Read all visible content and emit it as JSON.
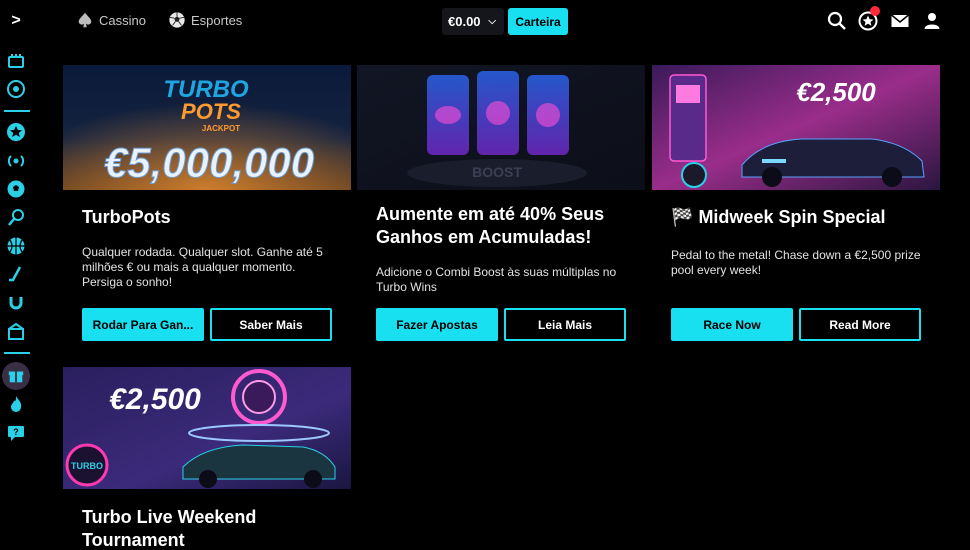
{
  "nav": {
    "casino_label": "Cassino",
    "sports_label": "Esportes",
    "balance": "€0.00",
    "wallet_label": "Carteira"
  },
  "sidebar": {
    "icons": [
      "casino-chips-icon",
      "roulette-icon",
      "favorites-star-icon",
      "live-broadcast-icon",
      "soccer-ball-icon",
      "tennis-racket-icon",
      "basketball-icon",
      "hockey-stick-icon",
      "horseshoe-icon",
      "betting-shop-icon",
      "gift-icon",
      "fire-icon",
      "help-chat-icon"
    ]
  },
  "cards": [
    {
      "banner_text": "€5,000,000",
      "banner_logo_line1": "TURBO",
      "banner_logo_line2": "POTS",
      "banner_logo_line3": "JACKPOT",
      "title": "TurboPots",
      "description": "Qualquer rodada. Qualquer slot. Ganhe até 5 milhões € ou mais a qualquer momento. Persiga o sonho!",
      "primary_button": "Rodar Para Gan...",
      "secondary_button": "Saber Mais"
    },
    {
      "banner_text": "BOOST",
      "title": "Aumente em até 40% Seus Ganhos em Acumuladas!",
      "description": "Adicione o Combi Boost às suas múltiplas no Turbo Wins",
      "primary_button": "Fazer Apostas",
      "secondary_button": "Leia Mais"
    },
    {
      "banner_text": "€2,500",
      "title_flag": "🏁",
      "title": "Midweek Spin Special",
      "description": "Pedal to the metal! Chase down a €2,500 prize pool every week!",
      "primary_button": "Race Now",
      "secondary_button": "Read More"
    },
    {
      "banner_text": "€2,500",
      "banner_sign": "TURBO",
      "title": "Turbo Live Weekend Tournament"
    }
  ],
  "colors": {
    "accent": "#19e0f0",
    "background": "#000000",
    "notification": "#ff2a3c"
  }
}
